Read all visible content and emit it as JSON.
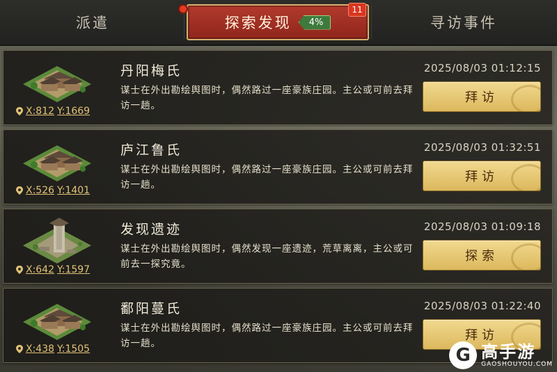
{
  "tabs": {
    "dispatch": "派遣",
    "explore": "探索发现",
    "explore_percent": "4%",
    "explore_count": "11",
    "visit": "寻访事件"
  },
  "events": [
    {
      "title": "丹阳梅氏",
      "time": "2025/08/03 01:12:15",
      "desc": "谋士在外出勘绘舆图时，偶然路过一座豪族庄园。主公或可前去拜访一趟。",
      "x": "X:812",
      "y": "Y:1669",
      "action": "拜访",
      "icon": "manor-icon"
    },
    {
      "title": "庐江鲁氏",
      "time": "2025/08/03 01:32:51",
      "desc": "谋士在外出勘绘舆图时，偶然路过一座豪族庄园。主公或可前去拜访一趟。",
      "x": "X:526",
      "y": "Y:1401",
      "action": "拜访",
      "icon": "manor-icon"
    },
    {
      "title": "发现遗迹",
      "time": "2025/08/03 01:09:18",
      "desc": "谋士在外出勘绘舆图时，偶然发现一座遗迹，荒草离离，主公或可前去一探究竟。",
      "x": "X:642",
      "y": "Y:1597",
      "action": "探索",
      "icon": "ruins-icon"
    },
    {
      "title": "鄱阳蔓氏",
      "time": "2025/08/03 01:22:40",
      "desc": "谋士在外出勘绘舆图时，偶然路过一座豪族庄园。主公或可前去拜访一趟。",
      "x": "X:438",
      "y": "Y:1505",
      "action": "拜访",
      "icon": "manor-icon"
    }
  ],
  "watermark": {
    "logo": "G",
    "name": "高手游",
    "url": "GAOSHOUYOU.COM"
  },
  "colors": {
    "active_tab": "#9e2c22",
    "button": "#e8c870",
    "coords": "#e2c277"
  }
}
